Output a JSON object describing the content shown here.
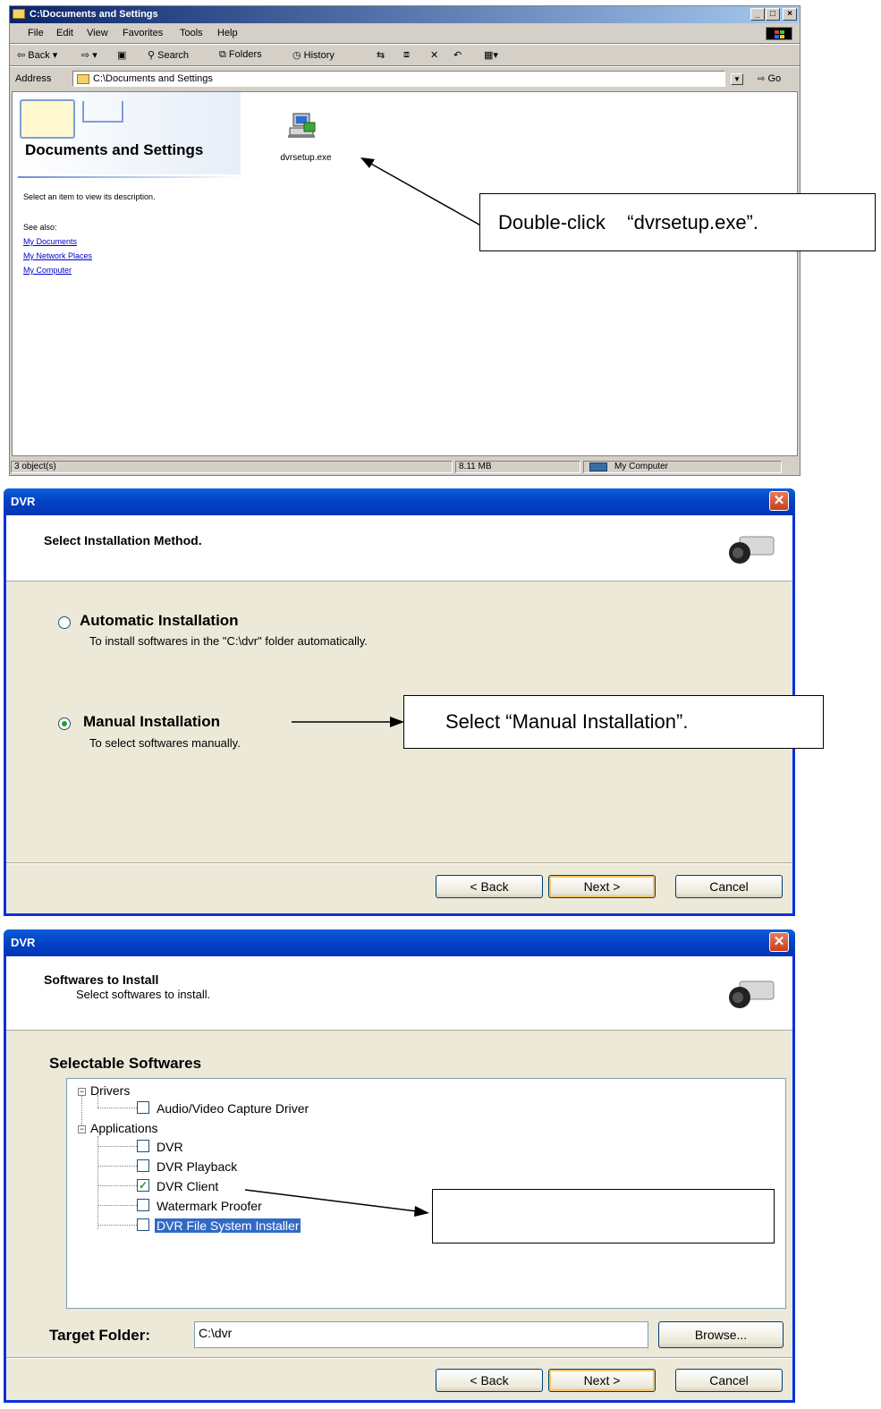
{
  "explorer": {
    "title": "C:\\Documents and Settings",
    "menu": [
      "File",
      "Edit",
      "View",
      "Favorites",
      "Tools",
      "Help"
    ],
    "toolbar": [
      "Back",
      "Search",
      "Folders",
      "History"
    ],
    "address_label": "Address",
    "address_value": "C:\\Documents and Settings",
    "go_label": "Go",
    "side_title": "Documents and Settings",
    "side_desc": "Select an item to view its description.",
    "see_also": "See also:",
    "links": [
      "My Documents",
      "My Network Places",
      "My Computer"
    ],
    "file_name": "dvrsetup.exe",
    "status_objects": "3 object(s)",
    "status_size": "8.11 MB",
    "status_location": "My Computer"
  },
  "callouts": {
    "double_click": "Double-click    “dvrsetup.exe”.",
    "select_manual": "Select “Manual Installation”.",
    "third": ""
  },
  "dialog1": {
    "title": "DVR",
    "heading": "Select Installation Method.",
    "auto_title": "Automatic Installation",
    "auto_desc": "To install softwares in the \"C:\\dvr\" folder automatically.",
    "manual_title": "Manual Installation",
    "manual_desc": "To select softwares manually.",
    "selected": "Manual Installation",
    "back": "< Back",
    "next": "Next >",
    "cancel": "Cancel"
  },
  "dialog2": {
    "title": "DVR",
    "heading": "Softwares to Install",
    "subheading": "Select softwares to install.",
    "group_label": "Selectable Softwares",
    "tree": {
      "drivers": "Drivers",
      "driver_items": [
        {
          "label": "Audio/Video Capture Driver",
          "checked": false
        }
      ],
      "applications": "Applications",
      "app_items": [
        {
          "label": "DVR",
          "checked": false
        },
        {
          "label": "DVR Playback",
          "checked": false
        },
        {
          "label": "DVR Client",
          "checked": true
        },
        {
          "label": "Watermark Proofer",
          "checked": false
        },
        {
          "label": "DVR File System Installer",
          "checked": false,
          "highlighted": true
        }
      ]
    },
    "target_label": "Target Folder:",
    "target_value": "C:\\dvr",
    "browse": "Browse...",
    "back": "< Back",
    "next": "Next >",
    "cancel": "Cancel"
  },
  "colors": {
    "xp_titlebar": "#0446c8",
    "selection": "#316ac5",
    "classic_face": "#d4d0c8",
    "xp_face": "#ece9d8"
  }
}
